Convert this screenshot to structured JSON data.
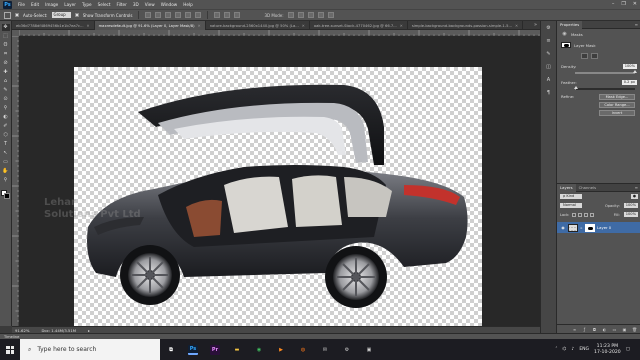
{
  "app": {
    "name": "Ps",
    "accent": "#31a8ff"
  },
  "menu": [
    "File",
    "Edit",
    "Image",
    "Layer",
    "Type",
    "Select",
    "Filter",
    "3D",
    "View",
    "Window",
    "Help"
  ],
  "window_controls": [
    "–",
    "❐",
    "✕"
  ],
  "options": {
    "auto_select_label": "Auto-Select:",
    "auto_select_value": "Group",
    "show_transform_label": "Show Transform Controls",
    "mode_3d_label": "3D Mode:"
  },
  "tabs": [
    {
      "label": "eb36d7788df4869456b1e1b7ea7c...",
      "active": false
    },
    {
      "label": "maxresdefault.jpg @ 91.6% (Layer 0, Layer Mask/8)",
      "active": true
    },
    {
      "label": "nature-background-2560x1440.jpg @ 50% (La...",
      "active": false
    },
    {
      "label": "oak-tree-sunset-Stock-4770462.jpg @ 66.7...",
      "active": false
    },
    {
      "label": "simple-background-backgrounds-passion-simple-1-5...",
      "active": false
    }
  ],
  "tab_overflow": "»",
  "toolbar_tools": [
    "✥",
    "⬚",
    "ʘ",
    "⌗",
    "⊘",
    "✚",
    "⌂",
    "✎",
    "⊙",
    "⚲",
    "◐",
    "✐",
    "⬡",
    "T",
    "↖",
    "▭",
    "✋",
    "⚲"
  ],
  "watermark": {
    "line1": "Lehar",
    "line2": "Solutions Pvt Ltd"
  },
  "status": {
    "zoom": "91.62%",
    "doc": "Doc: 1.44M/3.51M",
    "arrow": "▸"
  },
  "timeline_label": "Timeline",
  "properties": {
    "tabs": [
      "Properties"
    ],
    "title_icon": "◉",
    "title": "Masks",
    "mask_type": "Layer Mask",
    "density_label": "Density:",
    "density_value": "100%",
    "density": 1.0,
    "feather_label": "Feather:",
    "feather_value": "0.2 px",
    "feather": 0.02,
    "refine_label": "Refine:",
    "refine_buttons": [
      "Mask Edge...",
      "Color Range...",
      "Invert"
    ]
  },
  "layers": {
    "tabs": [
      "Layers",
      "Channels"
    ],
    "kind_label": "ρ Kind",
    "blend_mode": "Normal",
    "opacity_label": "Opacity:",
    "opacity_value": "100%",
    "lock_label": "Lock:",
    "fill_label": "Fill:",
    "fill_value": "100%",
    "layer_name": "Layer 0"
  },
  "panel_strip_icons": [
    "⚙",
    "≡",
    "✎",
    "◫",
    "A",
    "¶"
  ],
  "taskbar": {
    "search_placeholder": "Type here to search",
    "apps": [
      {
        "name": "task-view",
        "glyph": "⧉",
        "color": "#ffffff",
        "bg": "transparent"
      },
      {
        "name": "photoshop",
        "glyph": "Ps",
        "color": "#31a8ff",
        "bg": "#0f1f35"
      },
      {
        "name": "premiere",
        "glyph": "Pr",
        "color": "#e88aff",
        "bg": "#2a0f3a"
      },
      {
        "name": "file-explorer",
        "glyph": "▬",
        "color": "#f5c542",
        "bg": "transparent"
      },
      {
        "name": "chrome",
        "glyph": "◉",
        "color": "#3fbf5f",
        "bg": "transparent"
      },
      {
        "name": "media-player",
        "glyph": "▶",
        "color": "#ff8a1f",
        "bg": "transparent"
      },
      {
        "name": "firefox",
        "glyph": "◍",
        "color": "#ff7a1a",
        "bg": "transparent"
      },
      {
        "name": "mail",
        "glyph": "✉",
        "color": "#cfcfcf",
        "bg": "transparent"
      },
      {
        "name": "settings",
        "glyph": "⚙",
        "color": "#cfcfcf",
        "bg": "transparent"
      },
      {
        "name": "app-extra",
        "glyph": "▣",
        "color": "#cfcfcf",
        "bg": "transparent"
      }
    ],
    "lang": "ENG",
    "time": "11:23 PM",
    "date": "17-10-2020"
  }
}
